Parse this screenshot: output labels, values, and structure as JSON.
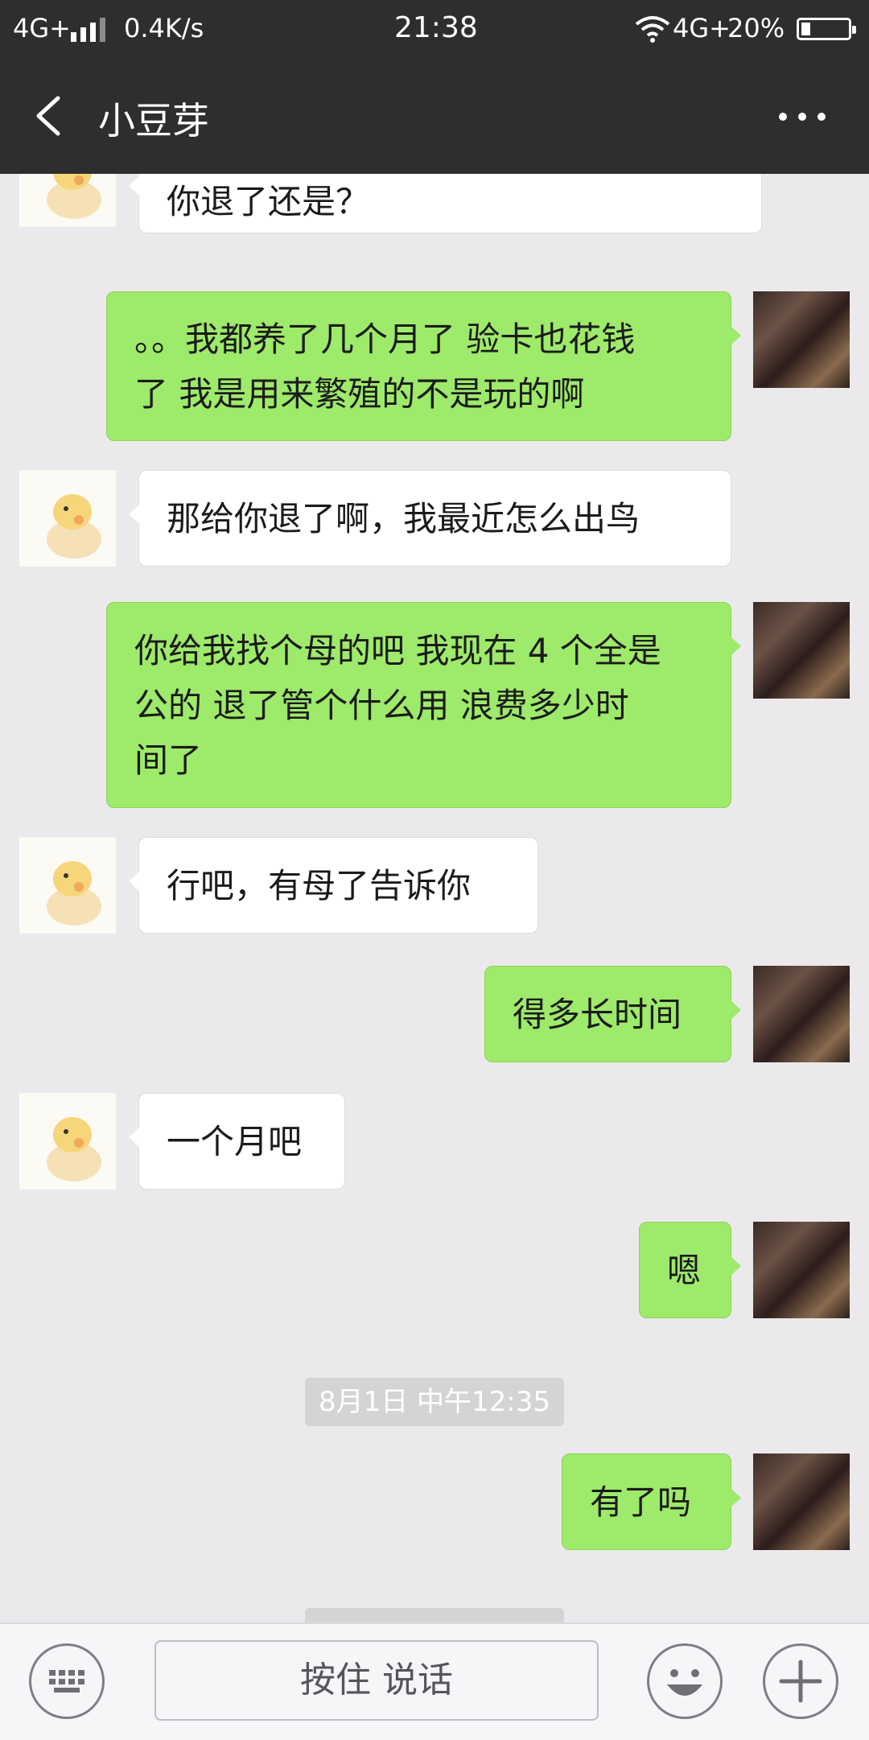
{
  "status_bar": {
    "network": "4G+",
    "speed": "0.4K/s",
    "time": "21:38",
    "network_right": "4G+",
    "battery": "20%",
    "battery_level": 0.2
  },
  "nav": {
    "title": "小豆芽",
    "back_icon": "chevron-left-icon",
    "more_icon": "more-dots-icon"
  },
  "messages": [
    {
      "side": "left",
      "text": "你退了还是？"
    },
    {
      "side": "right",
      "lines": [
        "。。我都养了几个月了 验卡也花钱",
        "了 我是用来繁殖的不是玩的啊"
      ]
    },
    {
      "side": "left",
      "text": "那给你退了啊，我最近怎么出鸟"
    },
    {
      "side": "right",
      "lines": [
        "你给我找个母的吧 我现在 4 个全是",
        "公的 退了管个什么用 浪费多少时",
        "间了"
      ]
    },
    {
      "side": "left",
      "text": "行吧，有母了告诉你"
    },
    {
      "side": "right",
      "text": "得多长时间"
    },
    {
      "side": "left",
      "text": "一个月吧"
    },
    {
      "side": "right",
      "text": "嗯"
    },
    {
      "side": "right",
      "text": "有了吗"
    }
  ],
  "timestamps": [
    "8月1日 中午12:35"
  ],
  "input_bar": {
    "keyboard_icon": "keyboard-icon",
    "hold_to_talk": "按住 说话",
    "emoji_icon": "emoji-icon",
    "plus_icon": "plus-icon"
  },
  "colors": {
    "header_bg": "#2e2e2e",
    "chat_bg": "#ece9ec",
    "bubble_sent": "#9eea6a",
    "bubble_received": "#ffffff"
  }
}
